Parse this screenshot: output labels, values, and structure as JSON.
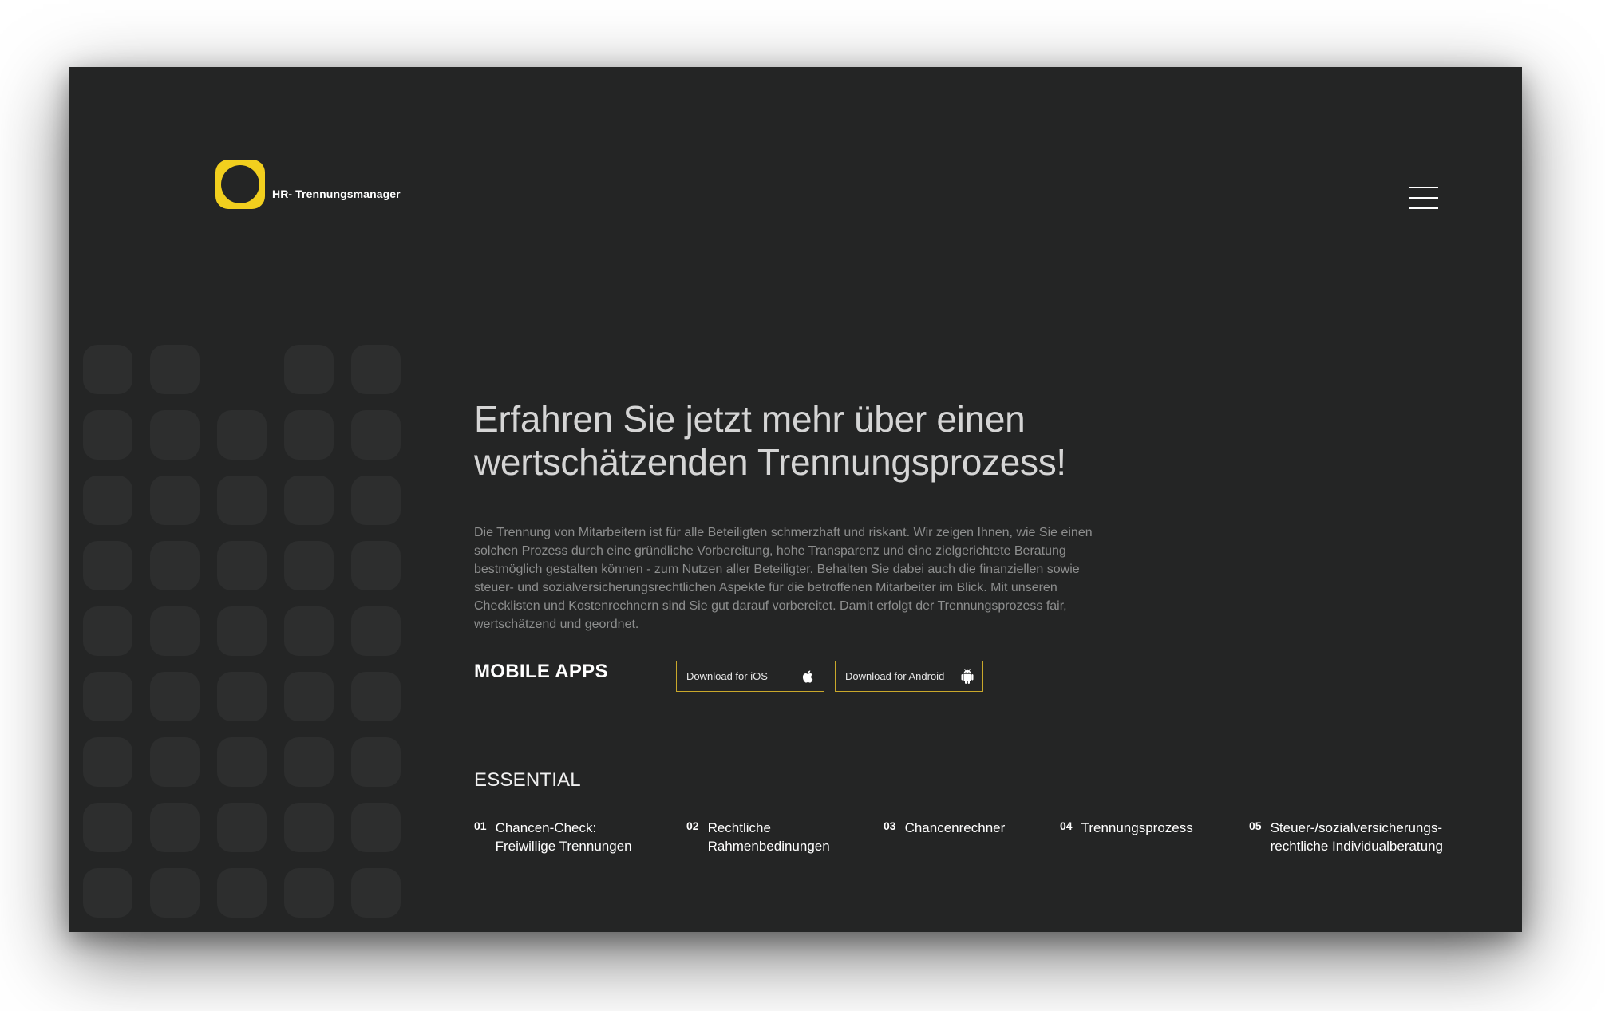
{
  "brand": {
    "name": "HR- Trennungsmanager",
    "accent": "#f2cf1e"
  },
  "header": {
    "menu_icon": "hamburger-menu-icon"
  },
  "hero": {
    "title_line1": "Erfahren Sie jetzt mehr über einen",
    "title_line2": "wertschätzenden Trennungsprozess!",
    "body": "Die Trennung von Mitarbeitern ist für alle Beteiligten schmerzhaft und riskant. Wir zeigen Ihnen, wie Sie einen solchen Prozess durch eine gründliche Vorbereitung, hohe Transparenz und eine zielgerichtete Beratung bestmöglich gestalten können - zum Nutzen aller Beteiligter. Behalten Sie dabei auch die finanziellen sowie steuer- und sozialversicherungsrechtlichen Aspekte für die betroffenen Mitarbeiter im Blick. Mit unseren Checklisten und Kostenrechnern sind Sie gut darauf vorbereitet. Damit erfolgt der Trennungsprozess fair, wertschätzend und geordnet."
  },
  "apps": {
    "label": "MOBILE APPS",
    "ios": {
      "label": "Download for iOS",
      "icon": "apple-icon"
    },
    "android": {
      "label": "Download for Android",
      "icon": "android-icon"
    }
  },
  "essential": {
    "label": "ESSENTIAL",
    "items": [
      {
        "num": "01",
        "line1": "Chancen-Check:",
        "line2": "Freiwillige Trennungen"
      },
      {
        "num": "02",
        "line1": "Rechtliche",
        "line2": "Rahmenbedinungen"
      },
      {
        "num": "03",
        "line1": "Chancenrechner",
        "line2": ""
      },
      {
        "num": "04",
        "line1": "Trennungsprozess",
        "line2": ""
      },
      {
        "num": "05",
        "line1": "Steuer-/sozialversicherungs-",
        "line2": "rechtliche Individualberatung"
      }
    ]
  }
}
